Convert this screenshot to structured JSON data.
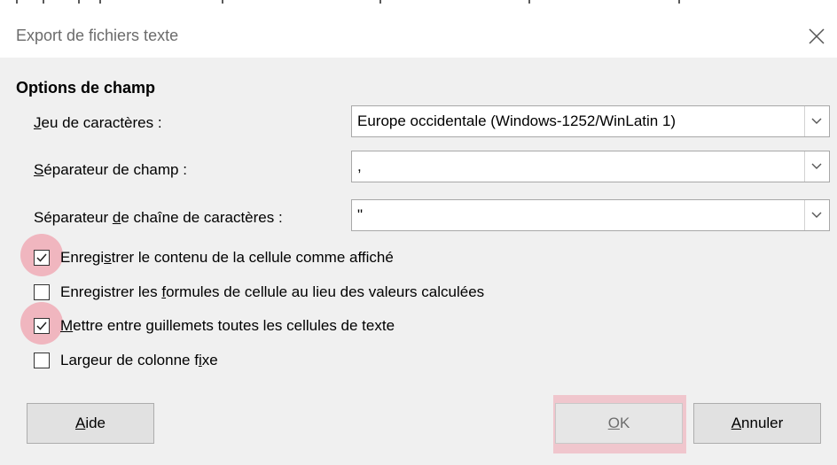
{
  "window": {
    "title": "Export de fichiers texte"
  },
  "section": {
    "heading": "Options de champ"
  },
  "fields": {
    "charset": {
      "label_mnemonic": "J",
      "label_rest": "eu de caractères :",
      "value": "Europe occidentale (Windows-1252/WinLatin 1)"
    },
    "field_separator": {
      "label_mnemonic": "S",
      "label_rest": "éparateur de champ :",
      "value": ","
    },
    "string_separator": {
      "label_pre": "Séparateur ",
      "label_mnemonic": "d",
      "label_rest": "e chaîne de caractères :",
      "value": "\""
    }
  },
  "checkboxes": [
    {
      "pre": "Enregi",
      "mnemonic": "s",
      "post": "trer le contenu de la cellule comme affiché",
      "checked": true
    },
    {
      "pre": "Enregistrer les ",
      "mnemonic": "f",
      "post": "ormules de cellule au lieu des valeurs calculées",
      "checked": false
    },
    {
      "pre": "",
      "mnemonic": "M",
      "post": "ettre entre guillemets toutes les cellules de texte",
      "checked": true
    },
    {
      "pre": "Largeur de colonne f",
      "mnemonic": "i",
      "post": "xe",
      "checked": false
    }
  ],
  "buttons": {
    "help": {
      "mnemonic": "A",
      "rest": "ide"
    },
    "ok": {
      "mnemonic": "O",
      "rest": "K"
    },
    "cancel": {
      "mnemonic": "A",
      "rest": "nnuler"
    }
  },
  "icons": {
    "close": "close-icon",
    "dropdown": "chevron-down-icon",
    "check": "checkmark-icon"
  },
  "colors": {
    "dialog_bg": "#f0f0f0",
    "highlight": "#f06e82"
  }
}
